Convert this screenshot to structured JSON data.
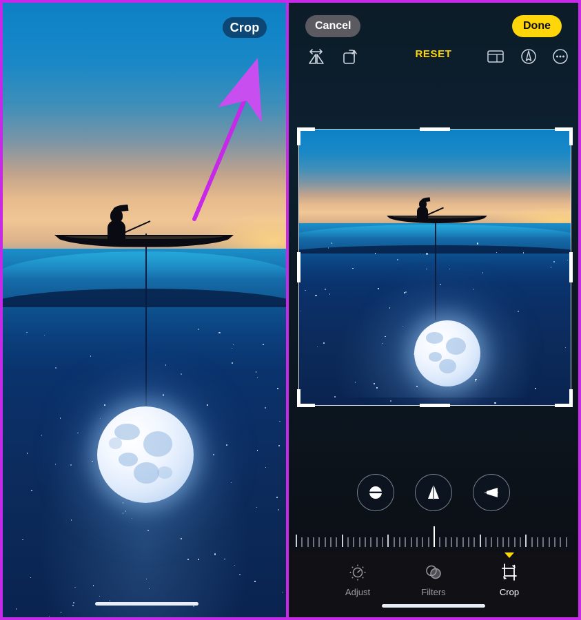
{
  "meta": {
    "app": "iPhone Photos Editor",
    "accent_yellow": "#ffd60a",
    "annotation_color": "#c729e8",
    "border_color": "#c729e8"
  },
  "left_panel": {
    "name": "photo-viewer",
    "crop_button_label": "Crop",
    "annotation": {
      "type": "arrow",
      "points_to": "Crop",
      "color": "#c729e8"
    },
    "artwork": {
      "title": "Fisherman and the Moon",
      "elements": [
        "sky-gradient",
        "sunset-horizon",
        "canoe",
        "fisherman-silhouette",
        "fishing-rod",
        "ocean",
        "underwater-stars",
        "moon-on-fishing-line"
      ]
    },
    "home_indicator": true
  },
  "right_panel": {
    "name": "crop-editor",
    "topbar": {
      "cancel_label": "Cancel",
      "done_label": "Done"
    },
    "toolbar": {
      "reset_label": "RESET",
      "icons": [
        {
          "name": "flip-horizontal-icon",
          "label": "Flip"
        },
        {
          "name": "rotate-left-icon",
          "label": "Rotate"
        },
        {
          "name": "aspect-ratio-icon",
          "label": "Aspect Ratio"
        },
        {
          "name": "auto-enhance-icon",
          "label": "Auto"
        },
        {
          "name": "more-options-icon",
          "label": "More"
        }
      ]
    },
    "crop_frame": {
      "visible": true,
      "handles": [
        "top-left",
        "top-center",
        "top-right",
        "left-center",
        "right-center",
        "bottom-left",
        "bottom-center",
        "bottom-right"
      ]
    },
    "rotation_controls": [
      {
        "name": "straighten-button",
        "label": "Straighten"
      },
      {
        "name": "vertical-perspective-button",
        "label": "Vertical Perspective"
      },
      {
        "name": "horizontal-perspective-button",
        "label": "Horizontal Perspective"
      }
    ],
    "ruler": {
      "name": "angle-ruler",
      "value": "0",
      "center_index": 24,
      "tick_count": 49
    },
    "modes": [
      {
        "name": "adjust",
        "label": "Adjust",
        "active": false
      },
      {
        "name": "filters",
        "label": "Filters",
        "active": false
      },
      {
        "name": "crop",
        "label": "Crop",
        "active": true
      }
    ],
    "home_indicator": true
  }
}
